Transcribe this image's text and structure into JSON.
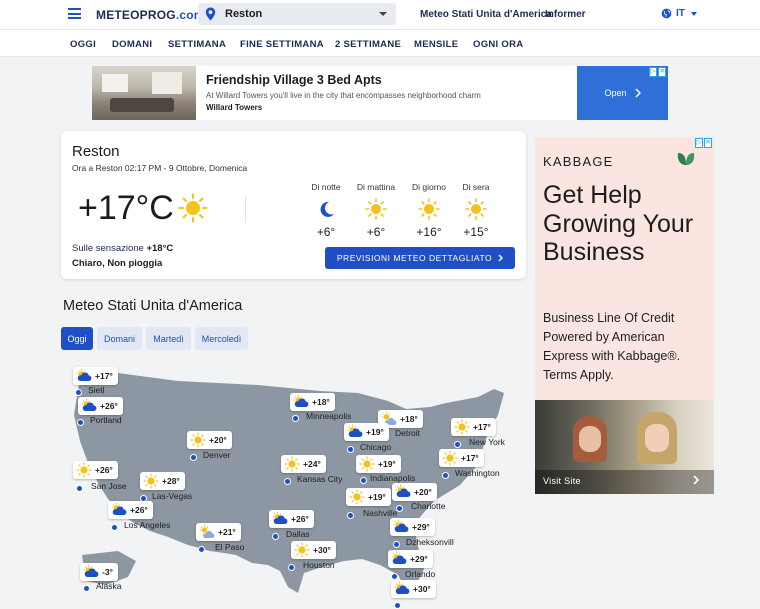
{
  "header": {
    "logo_main": "METEOPROG",
    "logo_domain": ".com",
    "search_value": "Reston",
    "links": [
      "Meteo Stati Unita d'America",
      "Informer"
    ],
    "language": "IT"
  },
  "nav": {
    "tabs": [
      "OGGI",
      "DOMANI",
      "SETTIMANA",
      "FINE SETTIMANA",
      "2 SETTIMANE",
      "MENSILE",
      "OGNI ORA"
    ]
  },
  "ad_top": {
    "title": "Friendship Village 3 Bed Apts",
    "description": "At Willard Towers you'll live in the city that encompasses neighborhood charm",
    "advertiser": "Willard Towers",
    "cta": "Open"
  },
  "current": {
    "city": "Reston",
    "timestamp": "Ora a Reston 02:17 PM - 9 Ottobre, Domenica",
    "temperature": "+17°C",
    "feels_label": "Sulle sensazione",
    "feels_value": "+18°C",
    "condition": "Chiaro, Non pioggia",
    "periods": [
      {
        "label": "Di notte",
        "icon": "moon-icon",
        "temp": "+6°"
      },
      {
        "label": "Di mattina",
        "icon": "sun-icon",
        "temp": "+6°"
      },
      {
        "label": "Di giorno",
        "icon": "sun-icon",
        "temp": "+16°"
      },
      {
        "label": "Di sera",
        "icon": "sun-icon",
        "temp": "+15°"
      }
    ],
    "detail_button": "PREVISIONI METEO DETTAGLIATO"
  },
  "country": {
    "title": "Meteo Stati Unita d'America",
    "day_tabs": [
      "Oggi",
      "Domani",
      "Martedì",
      "Mercoledì"
    ],
    "active_tab": "Oggi"
  },
  "map_cities": [
    {
      "name": "Sietl",
      "temp": "+17°",
      "icon": "partly-cloudy-icon"
    },
    {
      "name": "Portland",
      "temp": "+26°",
      "icon": "partly-cloudy-icon"
    },
    {
      "name": "Minneapolis",
      "temp": "+18°",
      "icon": "partly-cloudy-icon"
    },
    {
      "name": "Detroit",
      "temp": "+18°",
      "icon": "partly-sunny-icon"
    },
    {
      "name": "New York",
      "temp": "+17°",
      "icon": "sun-icon"
    },
    {
      "name": "Chicago",
      "temp": "+19°",
      "icon": "partly-cloudy-icon"
    },
    {
      "name": "Denver",
      "temp": "+20°",
      "icon": "sun-icon"
    },
    {
      "name": "Washington",
      "temp": "+17°",
      "icon": "sun-icon"
    },
    {
      "name": "Indianapolis",
      "temp": "+19°",
      "icon": "sun-icon"
    },
    {
      "name": "San Jose",
      "temp": "+26°",
      "icon": "sun-icon"
    },
    {
      "name": "Kansas City",
      "temp": "+24°",
      "icon": "sun-icon"
    },
    {
      "name": "Las-Vegas",
      "temp": "+28°",
      "icon": "sun-icon"
    },
    {
      "name": "Charlotte",
      "temp": "+20°",
      "icon": "partly-cloudy-icon"
    },
    {
      "name": "Nashville",
      "temp": "+19°",
      "icon": "sun-icon"
    },
    {
      "name": "Los Angeles",
      "temp": "+26°",
      "icon": "partly-cloudy-icon"
    },
    {
      "name": "Dallas",
      "temp": "+26°",
      "icon": "partly-cloudy-icon"
    },
    {
      "name": "El Paso",
      "temp": "+21°",
      "icon": "partly-sunny-icon"
    },
    {
      "name": "Dzheksonvill",
      "temp": "+29°",
      "icon": "partly-cloudy-icon"
    },
    {
      "name": "Houston",
      "temp": "+30°",
      "icon": "sun-icon"
    },
    {
      "name": "Orlando",
      "temp": "+29°",
      "icon": "partly-cloudy-icon"
    },
    {
      "name": "Alaska",
      "temp": "-3°",
      "icon": "partly-cloudy-icon"
    },
    {
      "name": "",
      "temp": "+30°",
      "icon": "partly-cloudy-icon"
    }
  ],
  "ad_side": {
    "brand": "KABBAGE",
    "headline": "Get Help Growing Your Business",
    "body": "Business Line Of Credit Powered by American Express with Kabbage®. Terms Apply.",
    "cta": "Visit Site"
  },
  "colors": {
    "brand_blue": "#1e4fc4",
    "map_land": "#8d97a3",
    "sun": "#f5c21b",
    "ad_side_bg": "#fbe5e1"
  }
}
